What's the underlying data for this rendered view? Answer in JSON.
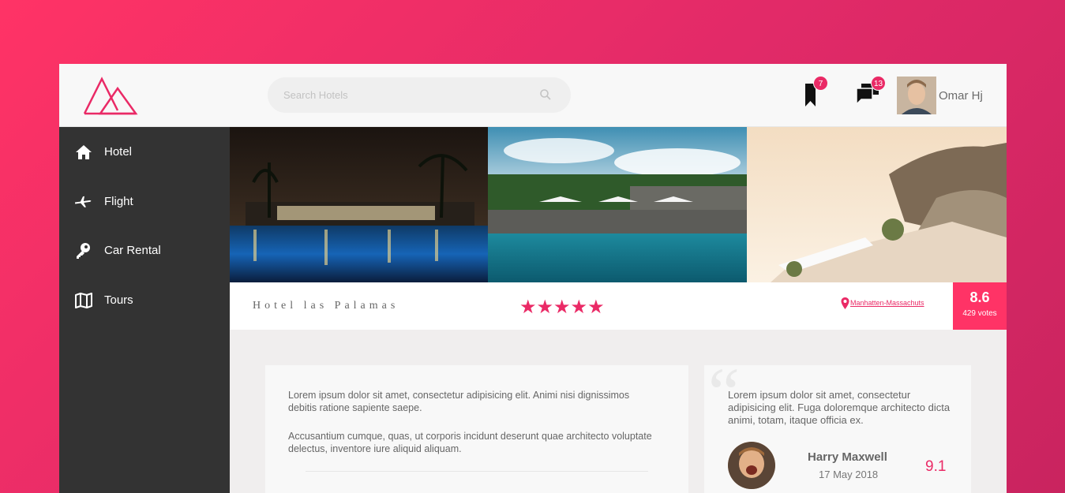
{
  "header": {
    "search_placeholder": "Search Hotels",
    "bookmarks_count": "7",
    "messages_count": "13",
    "user_name": "Omar Hj"
  },
  "sidebar": {
    "items": [
      {
        "label": "Hotel",
        "icon": "home-icon"
      },
      {
        "label": "Flight",
        "icon": "plane-icon"
      },
      {
        "label": "Car Rental",
        "icon": "key-icon"
      },
      {
        "label": "Tours",
        "icon": "map-icon"
      }
    ]
  },
  "hotel": {
    "name": "Hotel las Palamas",
    "stars": "★★★★★",
    "star_rating": 5,
    "location": "Manhatten-Massachuts",
    "score": "8.6",
    "votes": "429 votes"
  },
  "description": {
    "paragraph_1": "Lorem ipsum dolor sit amet, consectetur adipisicing elit. Animi nisi dignissimos debitis ratione sapiente saepe.",
    "paragraph_2": "Accusantium cumque, quas, ut corporis incidunt deserunt quae architecto voluptate delectus, inventore iure aliquid aliquam."
  },
  "review": {
    "text": "Lorem ipsum dolor sit amet, consectetur adipisicing elit. Fuga doloremque architecto dicta animi, totam, itaque officia ex.",
    "reviewer": "Harry Maxwell",
    "date": "17 May 2018",
    "score": "9.1"
  },
  "colors": {
    "accent": "#ea2a66",
    "sidebar_bg": "#333333",
    "background_gradient_start": "#ff3366",
    "background_gradient_end": "#c9245f"
  }
}
